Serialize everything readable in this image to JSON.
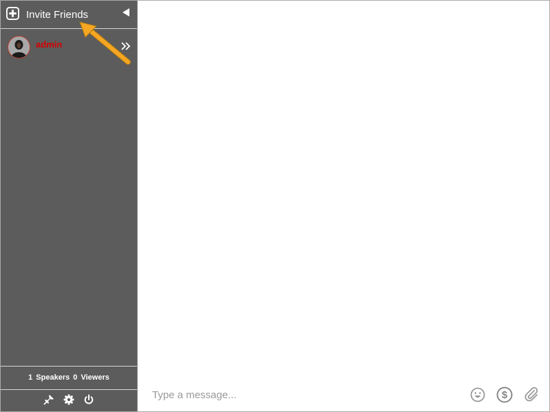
{
  "sidebar": {
    "invite_label": "Invite Friends",
    "user": {
      "name": "admin"
    },
    "counts": {
      "speakers_count": "1",
      "speakers_label": "Speakers",
      "viewers_count": "0",
      "viewers_label": "Viewers"
    },
    "bottom_icons": [
      "pin-icon",
      "gear-icon",
      "power-icon"
    ]
  },
  "composer": {
    "placeholder": "Type a message...",
    "icons": [
      "emoji-icon",
      "dollar-icon",
      "paperclip-icon"
    ]
  },
  "colors": {
    "sidebar_bg": "#5c5c5c",
    "username": "#d40000",
    "annotation_arrow": "#f5a623"
  }
}
